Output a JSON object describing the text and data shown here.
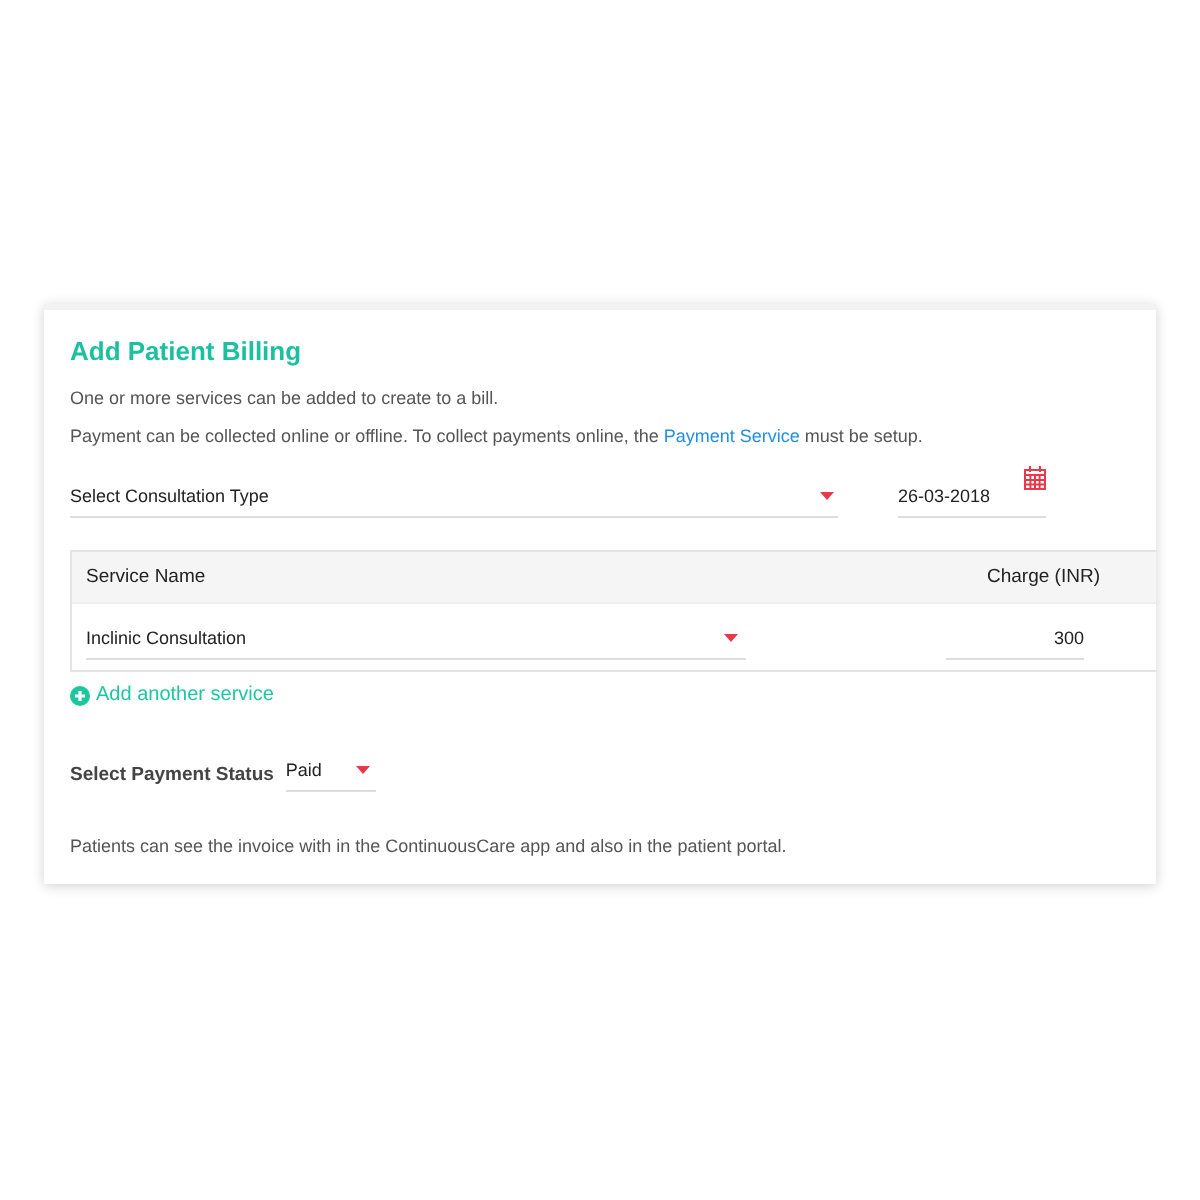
{
  "title": "Add Patient Billing",
  "intro": "One or more services can be added to create to a bill.",
  "payment_note": {
    "before": "Payment can be collected online or offline. To collect payments online, the ",
    "link": "Payment Service",
    "after": " must be setup."
  },
  "consultation_select": {
    "value": "Select Consultation Type"
  },
  "date_field": {
    "value": "26-03-2018"
  },
  "table": {
    "columns": [
      "Service Name",
      "Charge (INR)"
    ],
    "rows": [
      {
        "service": "Inclinic Consultation",
        "charge": "300"
      }
    ]
  },
  "add_service": "Add another service",
  "payment_status": {
    "label": "Select Payment Status",
    "value": "Paid"
  },
  "footer_note": "Patients can see the invoice with in the ContinuousCare app and also in the patient portal."
}
